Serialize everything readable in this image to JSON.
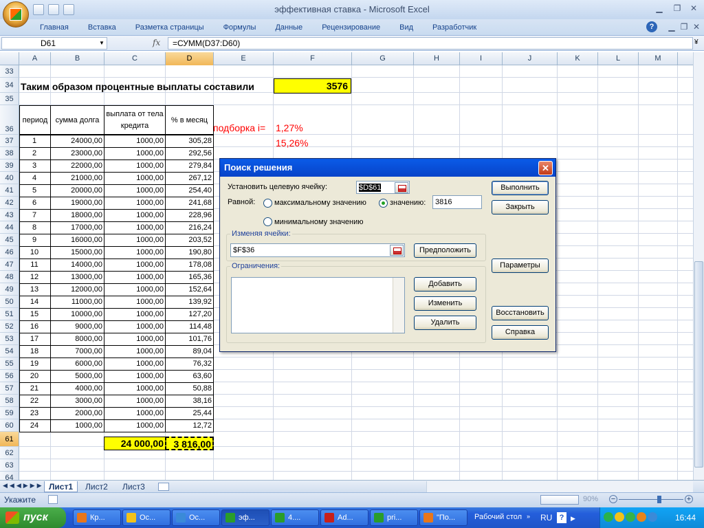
{
  "window": {
    "title": "эффективная ставка - Microsoft Excel"
  },
  "ribbon": {
    "tabs": [
      "Главная",
      "Вставка",
      "Разметка страницы",
      "Формулы",
      "Данные",
      "Рецензирование",
      "Вид",
      "Разработчик"
    ]
  },
  "formula_bar": {
    "name_box": "D61",
    "fx": "fx",
    "formula": "=СУММ(D37:D60)"
  },
  "columns": [
    "A",
    "B",
    "C",
    "D",
    "E",
    "F",
    "G",
    "H",
    "I",
    "J",
    "K",
    "L",
    "M"
  ],
  "row_numbers": [
    "33",
    "34",
    "35",
    "36",
    "37",
    "38",
    "39",
    "40",
    "41",
    "42",
    "43",
    "44",
    "45",
    "46",
    "47",
    "48",
    "49",
    "50",
    "51",
    "52",
    "53",
    "54",
    "55",
    "56",
    "57",
    "58",
    "59",
    "60",
    "61",
    "62",
    "63",
    "64"
  ],
  "sheet": {
    "row34_text": "Таким образом процентные выплаты составили",
    "row34_value": "3576",
    "headers": {
      "a": "период",
      "b": "сумма долга",
      "c": "выплата от тела кредита",
      "d": "% в месяц"
    },
    "podborka_label": "подборка i=",
    "rate_monthly": "1,27%",
    "rate_annual": "15,26%",
    "rows": [
      {
        "p": "1",
        "debt": "24000,00",
        "pay": "1000,00",
        "pct": "305,28"
      },
      {
        "p": "2",
        "debt": "23000,00",
        "pay": "1000,00",
        "pct": "292,56"
      },
      {
        "p": "3",
        "debt": "22000,00",
        "pay": "1000,00",
        "pct": "279,84"
      },
      {
        "p": "4",
        "debt": "21000,00",
        "pay": "1000,00",
        "pct": "267,12"
      },
      {
        "p": "5",
        "debt": "20000,00",
        "pay": "1000,00",
        "pct": "254,40"
      },
      {
        "p": "6",
        "debt": "19000,00",
        "pay": "1000,00",
        "pct": "241,68"
      },
      {
        "p": "7",
        "debt": "18000,00",
        "pay": "1000,00",
        "pct": "228,96"
      },
      {
        "p": "8",
        "debt": "17000,00",
        "pay": "1000,00",
        "pct": "216,24"
      },
      {
        "p": "9",
        "debt": "16000,00",
        "pay": "1000,00",
        "pct": "203,52"
      },
      {
        "p": "10",
        "debt": "15000,00",
        "pay": "1000,00",
        "pct": "190,80"
      },
      {
        "p": "11",
        "debt": "14000,00",
        "pay": "1000,00",
        "pct": "178,08"
      },
      {
        "p": "12",
        "debt": "13000,00",
        "pay": "1000,00",
        "pct": "165,36"
      },
      {
        "p": "13",
        "debt": "12000,00",
        "pay": "1000,00",
        "pct": "152,64"
      },
      {
        "p": "14",
        "debt": "11000,00",
        "pay": "1000,00",
        "pct": "139,92"
      },
      {
        "p": "15",
        "debt": "10000,00",
        "pay": "1000,00",
        "pct": "127,20"
      },
      {
        "p": "16",
        "debt": "9000,00",
        "pay": "1000,00",
        "pct": "114,48"
      },
      {
        "p": "17",
        "debt": "8000,00",
        "pay": "1000,00",
        "pct": "101,76"
      },
      {
        "p": "18",
        "debt": "7000,00",
        "pay": "1000,00",
        "pct": "89,04"
      },
      {
        "p": "19",
        "debt": "6000,00",
        "pay": "1000,00",
        "pct": "76,32"
      },
      {
        "p": "20",
        "debt": "5000,00",
        "pay": "1000,00",
        "pct": "63,60"
      },
      {
        "p": "21",
        "debt": "4000,00",
        "pay": "1000,00",
        "pct": "50,88"
      },
      {
        "p": "22",
        "debt": "3000,00",
        "pay": "1000,00",
        "pct": "38,16"
      },
      {
        "p": "23",
        "debt": "2000,00",
        "pay": "1000,00",
        "pct": "25,44"
      },
      {
        "p": "24",
        "debt": "1000,00",
        "pay": "1000,00",
        "pct": "12,72"
      }
    ],
    "total_pay": "24 000,00",
    "total_pct": "3 816,00"
  },
  "dialog": {
    "title": "Поиск решения",
    "target_label": "Установить целевую ячейку:",
    "target_value": "$D$61",
    "equal_label": "Равной:",
    "opt_max": "максимальному значению",
    "opt_value": "значению:",
    "value_input": "3816",
    "opt_min": "минимальному значению",
    "changing_label": "Изменяя ячейки:",
    "changing_value": "$F$36",
    "constraints_label": "Ограничения:",
    "btn_run": "Выполнить",
    "btn_close": "Закрыть",
    "btn_guess": "Предположить",
    "btn_options": "Параметры",
    "btn_add": "Добавить",
    "btn_change": "Изменить",
    "btn_delete": "Удалить",
    "btn_reset": "Восстановить",
    "btn_help": "Справка"
  },
  "sheet_tabs": [
    "Лист1",
    "Лист2",
    "Лист3"
  ],
  "status": {
    "left": "Укажите",
    "zoom": "90%"
  },
  "taskbar": {
    "start": "пуск",
    "items": [
      "Кр...",
      "Ос...",
      "Ос...",
      "эф...",
      "4....",
      "Ad...",
      "pri...",
      "\"По..."
    ],
    "desktop": "Рабочий стол",
    "lang": "RU",
    "time": "16:44"
  },
  "colors": {
    "highlight_yellow": "#ffff00",
    "red_text": "#ff0000",
    "title_blue": "#0a5be8"
  }
}
